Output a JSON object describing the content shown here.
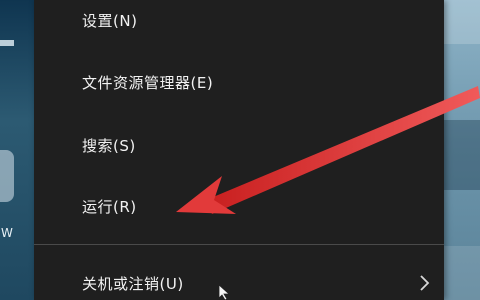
{
  "menu": {
    "items": [
      {
        "id": "settings",
        "label": "设置(N)"
      },
      {
        "id": "explorer",
        "label": "文件资源管理器(E)"
      },
      {
        "id": "search",
        "label": "搜索(S)"
      },
      {
        "id": "run",
        "label": "运行(R)"
      },
      {
        "id": "shutdown",
        "label": "关机或注销(U)",
        "has_submenu": true
      }
    ]
  },
  "desktop": {
    "icon_partial_letter": "W"
  },
  "colors": {
    "menu_bg": "#1f1f1f",
    "menu_text": "#f2f2f2",
    "annotation_arrow": "#e23a3a",
    "separator": "#4a4a4a"
  },
  "icons": {
    "submenu": "chevron-right-icon",
    "annotation": "red-arrow-annotation"
  }
}
